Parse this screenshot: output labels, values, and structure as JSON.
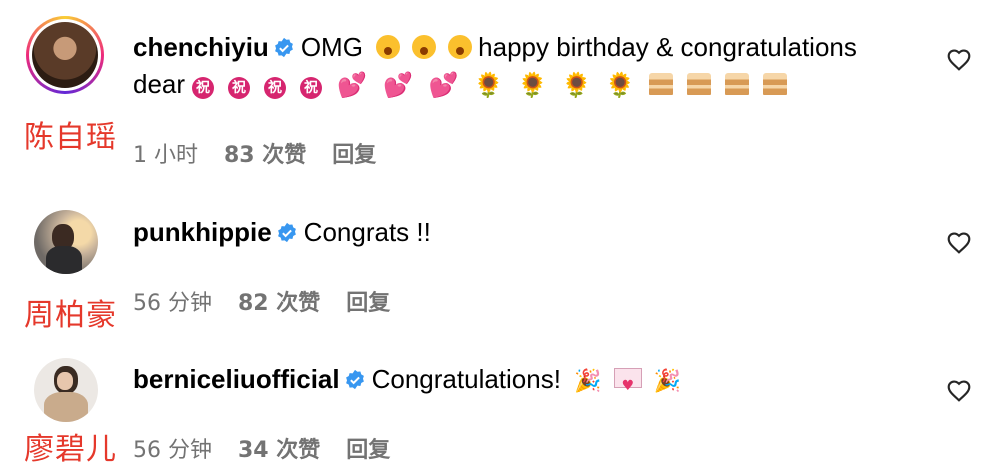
{
  "comments": [
    {
      "username": "chenchiyiu",
      "cn_name": "陈自瑶",
      "text_start": "OMG",
      "text_mid": "happy birthday & congratulations",
      "text_line2": "dear",
      "time": "1 小时",
      "likes": "83 次赞",
      "reply": "回复"
    },
    {
      "username": "punkhippie",
      "cn_name": "周柏豪",
      "text": "Congrats !!",
      "time": "56 分钟",
      "likes": "82 次赞",
      "reply": "回复"
    },
    {
      "username": "berniceliuofficial",
      "cn_name": "廖碧儿",
      "text": "Congratulations!",
      "time": "56 分钟",
      "likes": "34 次赞",
      "reply": "回复"
    }
  ],
  "emoji": {
    "zhu": "祝",
    "two_hearts": "💕",
    "sunflower": "🌻",
    "party": "🎉"
  },
  "colors": {
    "verified": "#3897f0",
    "cn_name": "#e5382b",
    "meta": "#737373"
  }
}
